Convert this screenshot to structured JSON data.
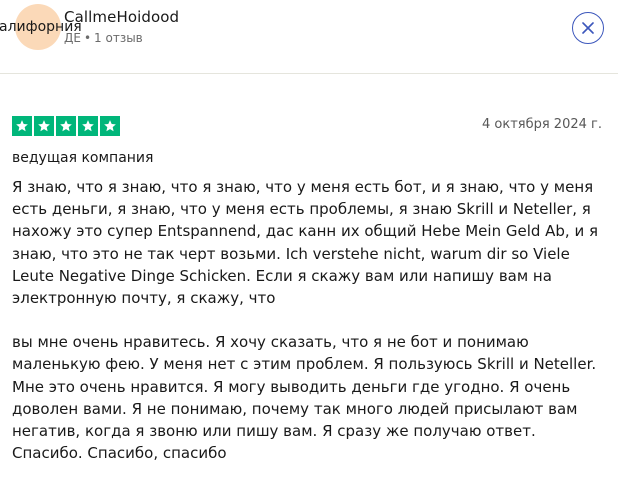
{
  "reviewer": {
    "avatar_text": "алифорния",
    "name": "CallmeHoidood",
    "country": "ДЕ",
    "reviews_count": "1 отзыв"
  },
  "review": {
    "rating": 5,
    "date": "4 октября 2024 г.",
    "title": "ведущая компания",
    "body": [
      "Я знаю, что я знаю, что я знаю, что у меня есть бот, и я знаю, что у меня есть деньги, я знаю, что у меня есть проблемы, я знаю Skrill и Neteller, я нахожу это супер Entspannend, дас канн их общий Hebe Mein Geld Ab, и я знаю, что это не так черт возьми. Ich verstehe nicht, warum dir so Viele Leute Negative Dinge Schicken. Если я скажу вам или напишу вам на электронную почту, я скажу, что",
      "вы мне очень нравитесь. Я хочу сказать, что я не бот и понимаю маленькую фею. У меня нет с этим проблем. Я пользуюсь Skrill и Neteller. Мне это очень нравится. Я могу выводить деньги где угодно. Я очень доволен вами. Я не понимаю, почему так много людей присылают вам негатив, когда я звоню или пишу вам. Я сразу же получаю ответ. Спасибо. Спасибо, спасибо"
    ]
  },
  "icons": {
    "close": "close-icon",
    "star": "star-icon"
  },
  "colors": {
    "star_green": "#00b67a",
    "close_border": "#3c57bc",
    "avatar_bg": "#fbd9b8"
  }
}
